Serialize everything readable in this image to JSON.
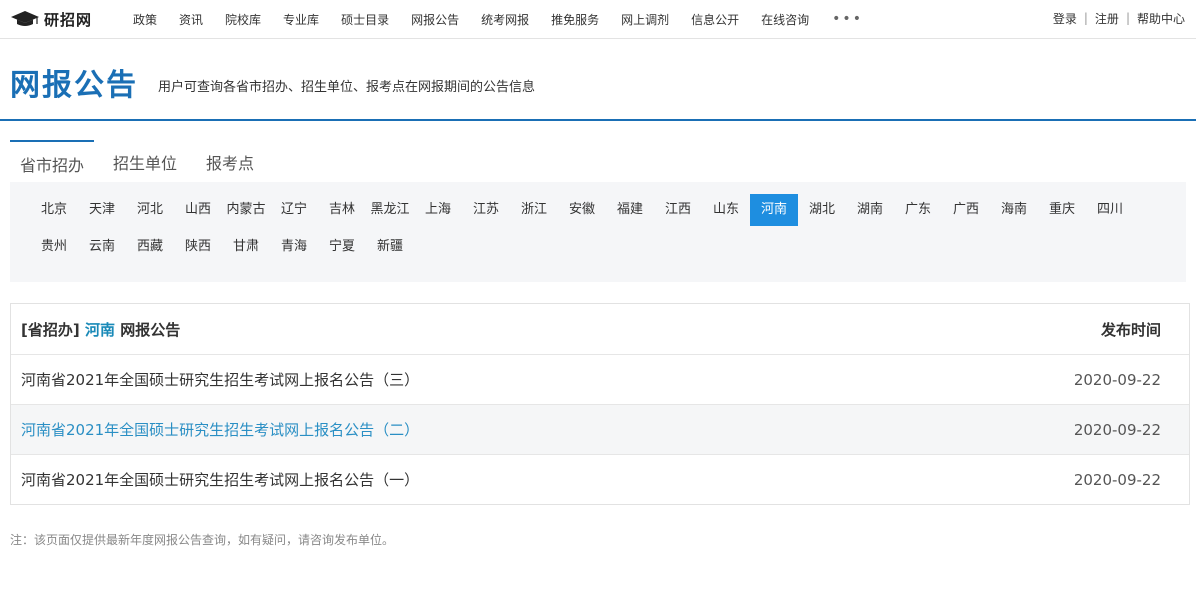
{
  "logo": {
    "text": "研招网"
  },
  "nav": {
    "items": [
      "政策",
      "资讯",
      "院校库",
      "专业库",
      "硕士目录",
      "网报公告",
      "统考网报",
      "推免服务",
      "网上调剂",
      "信息公开",
      "在线咨询"
    ],
    "more": "•••"
  },
  "user": {
    "login": "登录",
    "register": "注册",
    "help": "帮助中心",
    "sep": "|"
  },
  "header": {
    "title": "网报公告",
    "subtitle": "用户可查询各省市招办、招生单位、报考点在网报期间的公告信息"
  },
  "tabs": [
    "省市招办",
    "招生单位",
    "报考点"
  ],
  "provinces": {
    "row1": [
      "北京",
      "天津",
      "河北",
      "山西",
      "内蒙古",
      "辽宁",
      "吉林",
      "黑龙江",
      "上海",
      "江苏",
      "浙江",
      "安徽",
      "福建",
      "江西",
      "山东",
      "河南",
      "湖北",
      "湖南",
      "广东",
      "广西",
      "海南",
      "重庆",
      "四川"
    ],
    "row2": [
      "贵州",
      "云南",
      "西藏",
      "陕西",
      "甘肃",
      "青海",
      "宁夏",
      "新疆"
    ],
    "selected": "河南"
  },
  "table": {
    "head_prefix": "[省招办]",
    "head_province": "河南",
    "head_suffix": "网报公告",
    "date_header": "发布时间",
    "rows": [
      {
        "title": "河南省2021年全国硕士研究生招生考试网上报名公告（三）",
        "date": "2020-09-22"
      },
      {
        "title": "河南省2021年全国硕士研究生招生考试网上报名公告（二）",
        "date": "2020-09-22"
      },
      {
        "title": "河南省2021年全国硕士研究生招生考试网上报名公告（一）",
        "date": "2020-09-22"
      }
    ]
  },
  "note": "注：该页面仅提供最新年度网报公告查询，如有疑问，请咨询发布单位。",
  "colors": {
    "accent": "#1a6fb5",
    "selected_bg": "#1e8ee0",
    "link": "#2a8fc4"
  }
}
